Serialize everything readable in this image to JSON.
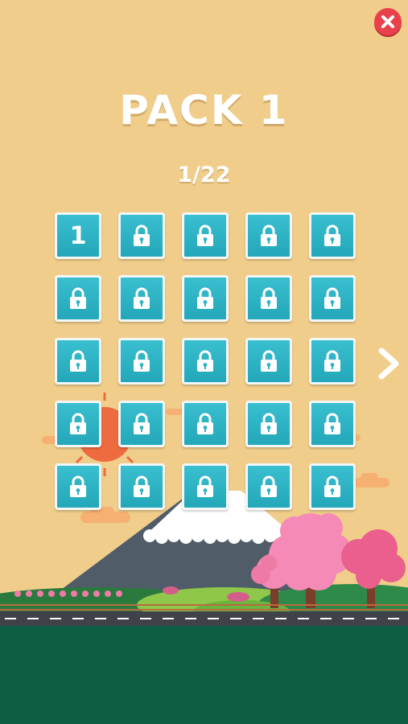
{
  "header": {
    "title": "PACK 1",
    "progress": "1/22"
  },
  "levels": [
    {
      "label": "1",
      "locked": false
    },
    {
      "label": "",
      "locked": true
    },
    {
      "label": "",
      "locked": true
    },
    {
      "label": "",
      "locked": true
    },
    {
      "label": "",
      "locked": true
    },
    {
      "label": "",
      "locked": true
    },
    {
      "label": "",
      "locked": true
    },
    {
      "label": "",
      "locked": true
    },
    {
      "label": "",
      "locked": true
    },
    {
      "label": "",
      "locked": true
    },
    {
      "label": "",
      "locked": true
    },
    {
      "label": "",
      "locked": true
    },
    {
      "label": "",
      "locked": true
    },
    {
      "label": "",
      "locked": true
    },
    {
      "label": "",
      "locked": true
    },
    {
      "label": "",
      "locked": true
    },
    {
      "label": "",
      "locked": true
    },
    {
      "label": "",
      "locked": true
    },
    {
      "label": "",
      "locked": true
    },
    {
      "label": "",
      "locked": true
    },
    {
      "label": "",
      "locked": true
    },
    {
      "label": "",
      "locked": true
    },
    {
      "label": "",
      "locked": true
    },
    {
      "label": "",
      "locked": true
    },
    {
      "label": "",
      "locked": true
    }
  ],
  "colors": {
    "background": "#f0cd8a",
    "tile": "#2fb4c6",
    "close_button": "#e8414b",
    "ground": "#0d5e42"
  },
  "icons": {
    "close": "close-x-icon",
    "next": "chevron-right-icon",
    "locked": "padlock-icon"
  }
}
